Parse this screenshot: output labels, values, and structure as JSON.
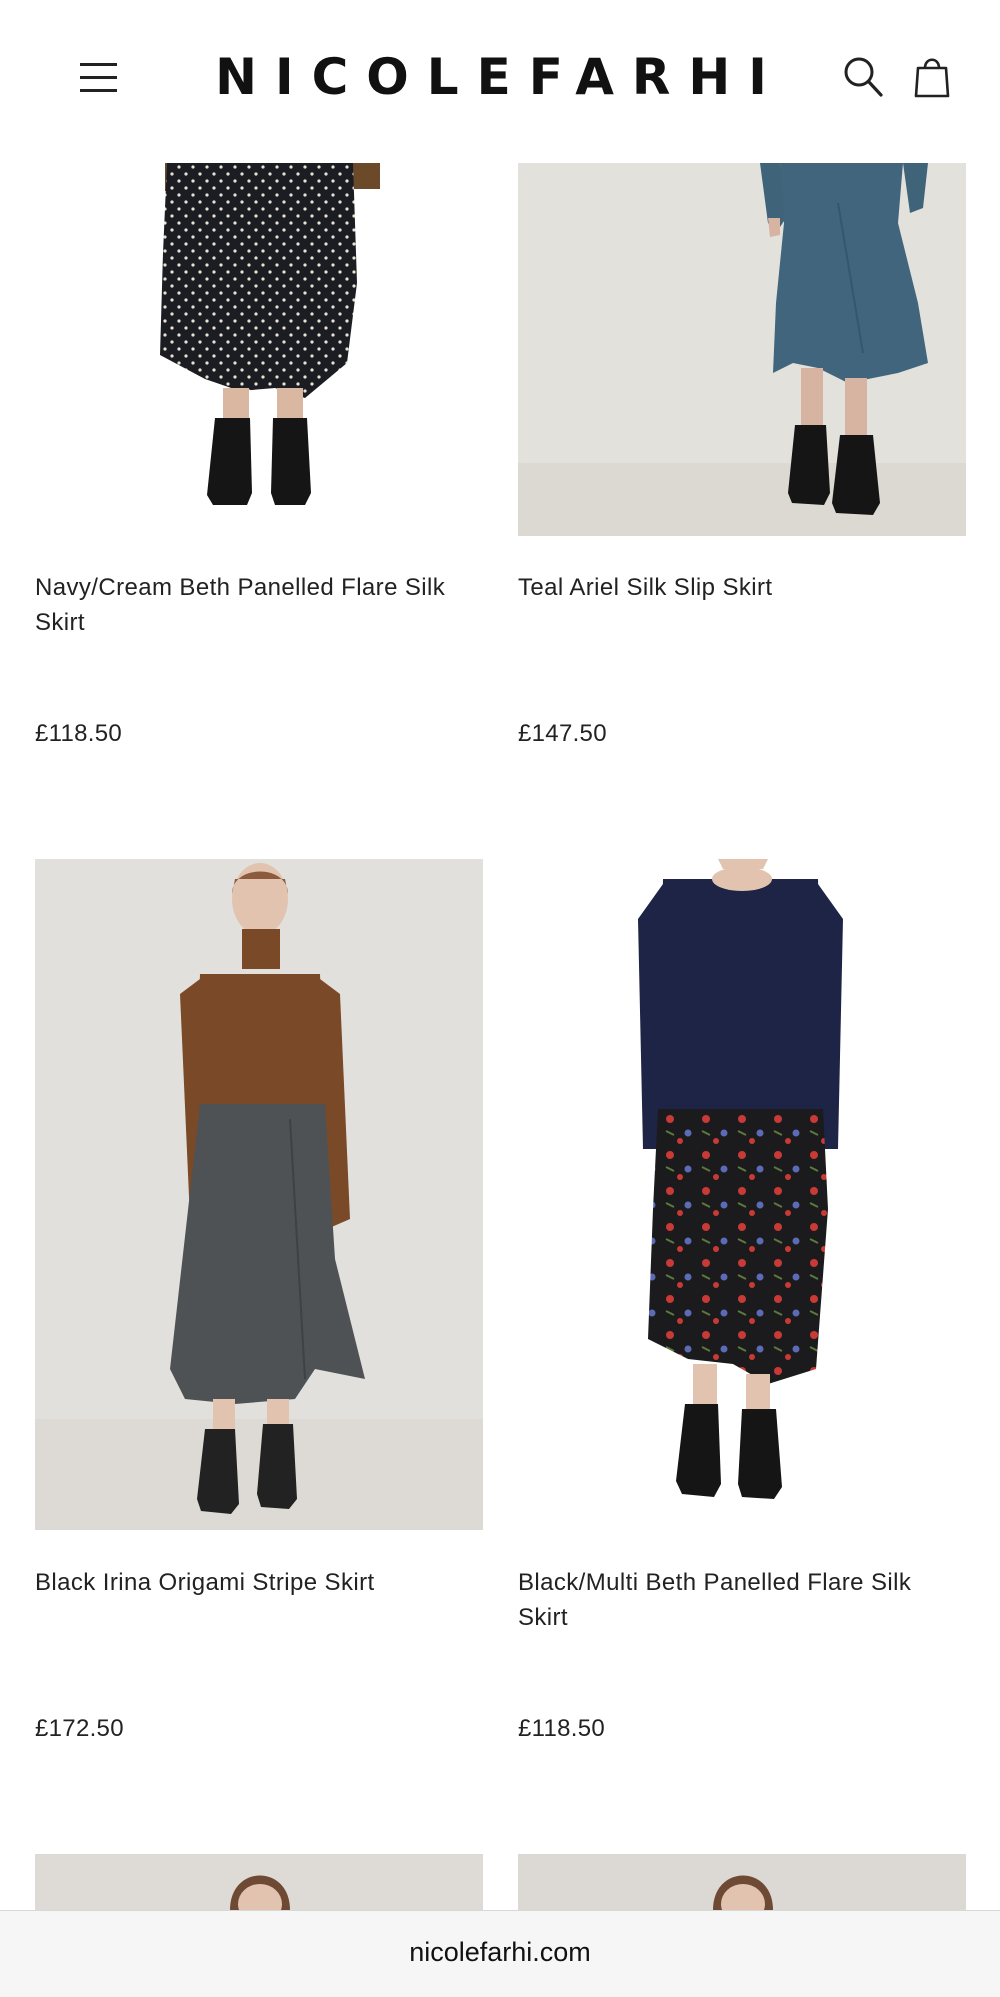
{
  "brand": {
    "logo": "NICOLEFARHI"
  },
  "header": {
    "menu_icon": "hamburger-menu-icon",
    "search_icon": "search-icon",
    "bag_icon": "shopping-bag-icon"
  },
  "products": [
    {
      "name": "Navy/Cream Beth Panelled Flare Silk Skirt",
      "price": "£118.50"
    },
    {
      "name": "Teal Ariel Silk Slip Skirt",
      "price": "£147.50"
    },
    {
      "name": "Black Irina Origami Stripe Skirt",
      "price": "£172.50"
    },
    {
      "name": "Black/Multi Beth Panelled Flare Silk Skirt",
      "price": "£118.50"
    }
  ],
  "browser": {
    "url": "nicolefarhi.com"
  },
  "colors": {
    "text": "#1a1a1a",
    "image_bg": "#e4e2de",
    "urlbar_bg": "#f6f6f6"
  }
}
